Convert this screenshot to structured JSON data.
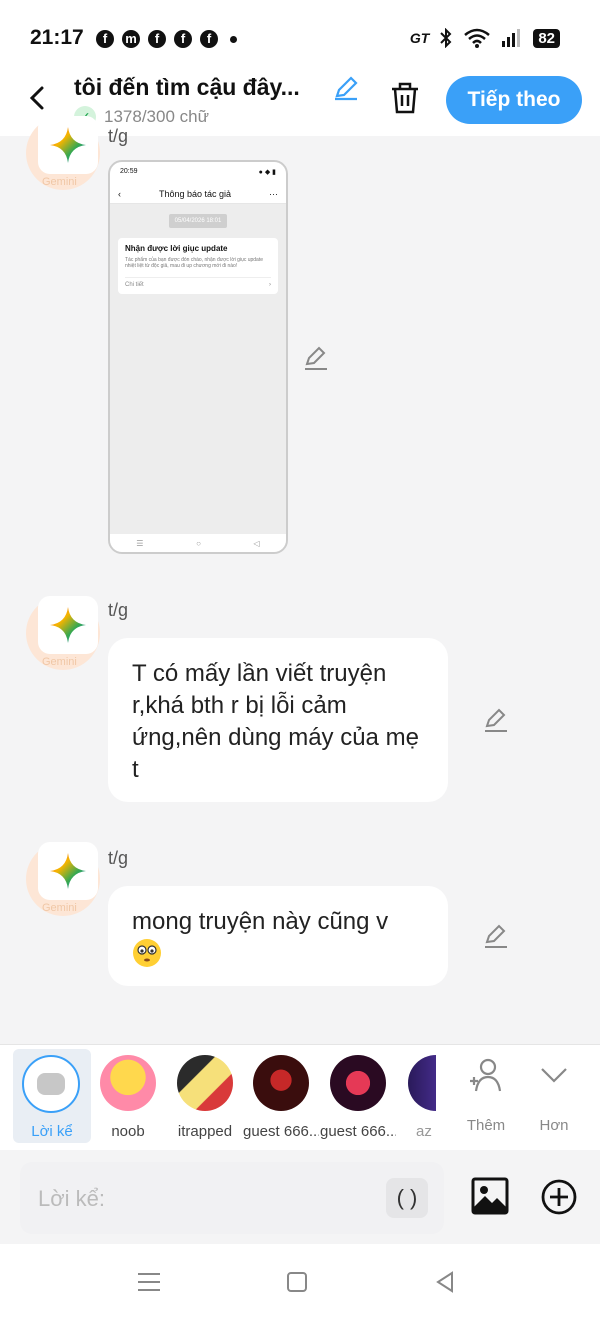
{
  "status": {
    "time": "21:17",
    "gt": "GT",
    "battery": "82"
  },
  "header": {
    "title": "tôi đến tìm cậu đây...",
    "word_count": "1378/300 chữ",
    "next_label": "Tiếp theo"
  },
  "messages": [
    {
      "sender": "t/g",
      "avatar_label": "Gemini",
      "type": "image"
    },
    {
      "sender": "t/g",
      "avatar_label": "Gemini",
      "text": "T có mấy lần viết truyện r,khá bth r bị lỗi cảm ứng,nên dùng máy của mẹ t"
    },
    {
      "sender": "t/g",
      "avatar_label": "Gemini",
      "text": "mong truyện này cũng v"
    }
  ],
  "embedded_screenshot": {
    "time": "20:59",
    "title": "Thông báo tác giả",
    "date": "05/04/2026 18:01",
    "card_title": "Nhận được lời giục update",
    "card_body": "Tác phẩm của bạn được đón chào, nhận được lời giục update nhiệt liệt từ độc giả, mau đi up chương mới đi nào!",
    "card_link": "Chi tiết"
  },
  "characters": [
    {
      "name": "Lời kể"
    },
    {
      "name": "noob"
    },
    {
      "name": "itrapped"
    },
    {
      "name": "guest 666..."
    },
    {
      "name": "guest 666..."
    },
    {
      "name": "az"
    }
  ],
  "picker_actions": {
    "add_label": "Thêm",
    "more_label": "Hơn"
  },
  "input": {
    "placeholder": "Lời kể:",
    "paren": "( )"
  },
  "colors": {
    "accent": "#3aa0f8",
    "background": "#f4f4f5"
  }
}
